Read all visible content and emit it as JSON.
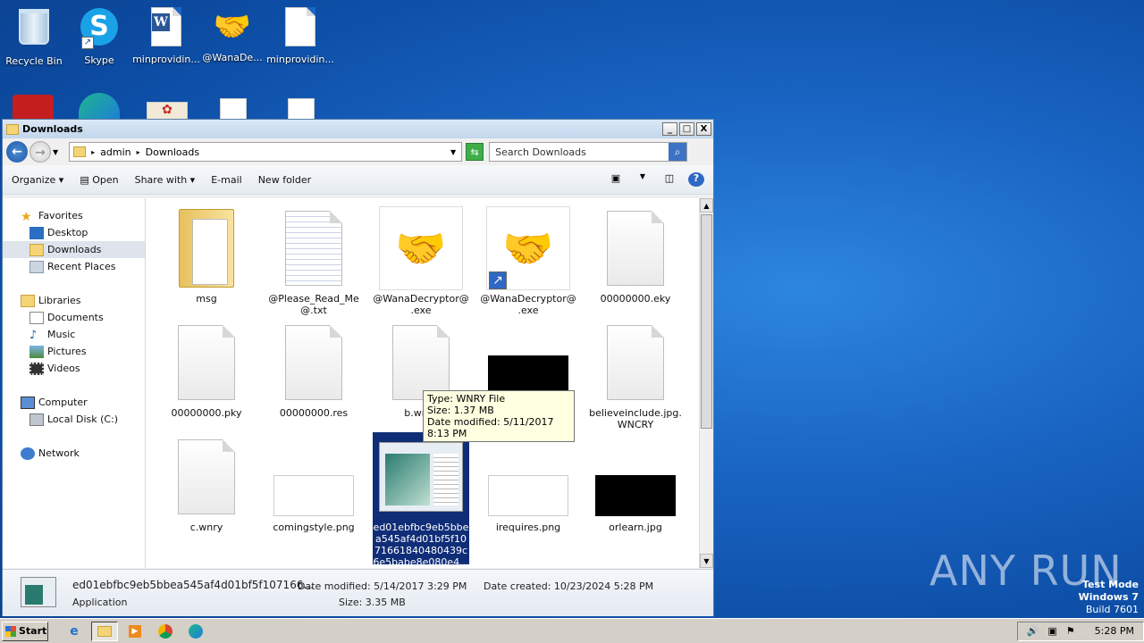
{
  "desktop": {
    "icons": [
      {
        "label": "Recycle Bin"
      },
      {
        "label": "Skype"
      },
      {
        "label": "minprovidin..."
      },
      {
        "label": "@WanaDe..."
      },
      {
        "label": "minprovidin..."
      }
    ]
  },
  "window": {
    "title": "Downloads",
    "controls": {
      "minimize": "_",
      "maximize": "□",
      "close": "X"
    },
    "address": {
      "part1": "admin",
      "part2": "Downloads"
    },
    "search_placeholder": "Search Downloads",
    "toolbar": {
      "organize": "Organize",
      "open": "Open",
      "share_with": "Share with",
      "email": "E-mail",
      "new_folder": "New folder"
    },
    "nav": {
      "favorites": "Favorites",
      "desktop": "Desktop",
      "downloads": "Downloads",
      "recent_places": "Recent Places",
      "libraries": "Libraries",
      "documents": "Documents",
      "music": "Music",
      "pictures": "Pictures",
      "videos": "Videos",
      "computer": "Computer",
      "local_disk": "Local Disk (C:)",
      "network": "Network"
    },
    "files": [
      {
        "name": "msg"
      },
      {
        "name": "@Please_Read_Me@.txt"
      },
      {
        "name": "@WanaDecryptor@.exe"
      },
      {
        "name": "@WanaDecryptor@.exe"
      },
      {
        "name": "00000000.eky"
      },
      {
        "name": "00000000.pky"
      },
      {
        "name": "00000000.res"
      },
      {
        "name": "b.wnry"
      },
      {
        "name": ""
      },
      {
        "name": "believeinclude.jpg.WNCRY"
      },
      {
        "name": "c.wnry"
      },
      {
        "name": "comingstyle.png"
      },
      {
        "name": "ed01ebfbc9eb5bbea545af4d01bf5f1071661840480439c6e5babe8e080e4..."
      },
      {
        "name": "irequires.png"
      },
      {
        "name": "orlearn.jpg"
      }
    ],
    "tooltip": {
      "type": "Type: WNRY File",
      "size": "Size: 1.37 MB",
      "modified": "Date modified: 5/11/2017 8:13 PM"
    },
    "details": {
      "filename": "ed01ebfbc9eb5bbea545af4d01bf5f107166...",
      "type": "Application",
      "date_modified": "Date modified: 5/14/2017 3:29 PM",
      "size": "Size: 3.35 MB",
      "date_created": "Date created: 10/23/2024 5:28 PM"
    }
  },
  "taskbar": {
    "start": "Start",
    "clock": "5:28 PM"
  },
  "watermark": "ANY RUN",
  "testmode": {
    "line1": "Test Mode",
    "line2": "Windows 7",
    "line3": "Build 7601"
  }
}
